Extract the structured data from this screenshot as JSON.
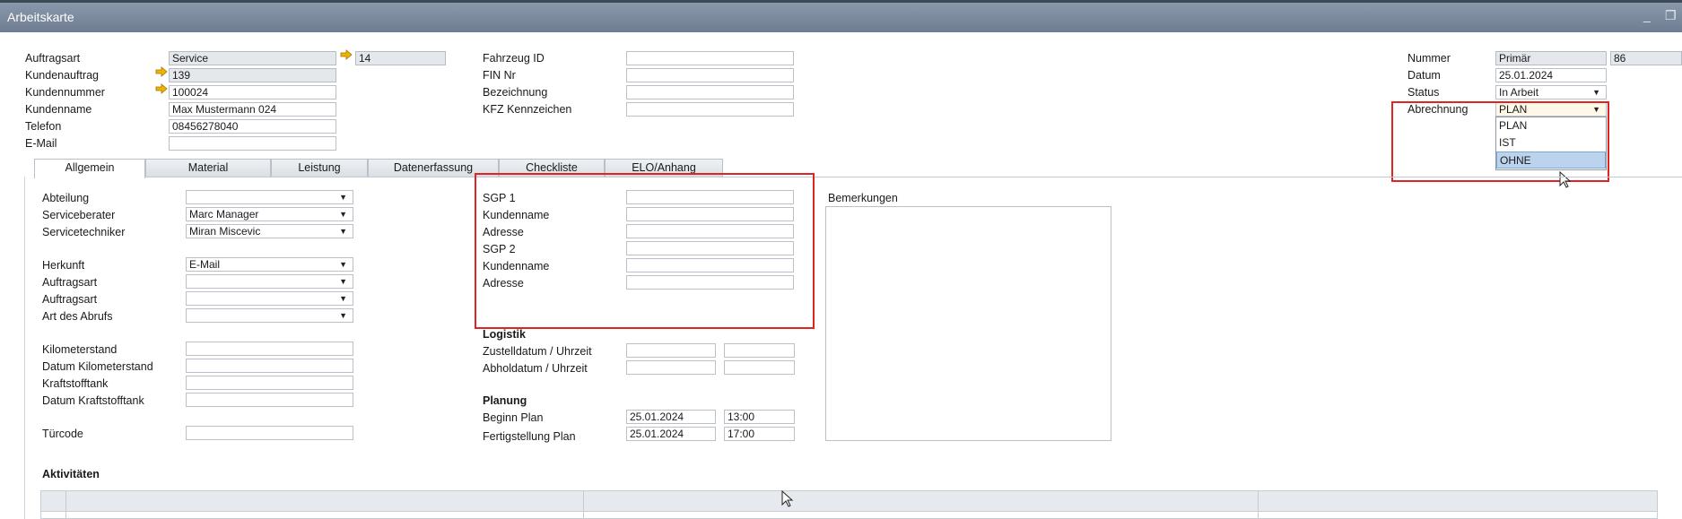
{
  "window": {
    "title": "Arbeitskarte",
    "minimize_label": "_",
    "restore_label": "❐"
  },
  "header_left": {
    "auftragsart": {
      "label": "Auftragsart",
      "value": "Service",
      "extra": "14"
    },
    "kundenauftrag": {
      "label": "Kundenauftrag",
      "value": "139"
    },
    "kundennummer": {
      "label": "Kundennummer",
      "value": "100024"
    },
    "kundenname": {
      "label": "Kundenname",
      "value": "Max Mustermann 024"
    },
    "telefon": {
      "label": "Telefon",
      "value": "08456278040"
    },
    "email": {
      "label": "E-Mail",
      "value": ""
    }
  },
  "header_mid": {
    "fahrzeug_id": {
      "label": "Fahrzeug ID",
      "value": ""
    },
    "fin_nr": {
      "label": "FIN Nr",
      "value": ""
    },
    "bezeichnung": {
      "label": "Bezeichnung",
      "value": ""
    },
    "kfz": {
      "label": "KFZ Kennzeichen",
      "value": ""
    }
  },
  "header_right": {
    "nummer": {
      "label": "Nummer",
      "series": "Primär",
      "value": "86"
    },
    "datum": {
      "label": "Datum",
      "value": "25.01.2024"
    },
    "status": {
      "label": "Status",
      "value": "In Arbeit"
    },
    "abrechnung": {
      "label": "Abrechnung",
      "value": "PLAN",
      "options": [
        "PLAN",
        "IST",
        "OHNE"
      ],
      "highlighted": "OHNE"
    }
  },
  "tabs": [
    "Allgemein",
    "Material",
    "Leistung",
    "Datenerfassung",
    "Checkliste",
    "ELO/Anhang"
  ],
  "allgemein": {
    "abteilung": {
      "label": "Abteilung",
      "value": ""
    },
    "serviceberater": {
      "label": "Serviceberater",
      "value": "Marc Manager"
    },
    "servicetechniker": {
      "label": "Servicetechniker",
      "value": "Miran Miscevic"
    },
    "herkunft": {
      "label": "Herkunft",
      "value": "E-Mail"
    },
    "auftragsart1": {
      "label": "Auftragsart",
      "value": ""
    },
    "auftragsart2": {
      "label": "Auftragsart",
      "value": ""
    },
    "art_abruf": {
      "label": "Art des Abrufs",
      "value": ""
    },
    "km": {
      "label": "Kilometerstand",
      "value": ""
    },
    "datum_km": {
      "label": "Datum Kilometerstand",
      "value": ""
    },
    "tank": {
      "label": "Kraftstofftank",
      "value": ""
    },
    "datum_tank": {
      "label": "Datum Kraftstofftank",
      "value": ""
    },
    "tuercode": {
      "label": "Türcode",
      "value": ""
    }
  },
  "sgp": {
    "sgp1": {
      "label": "SGP 1",
      "value": ""
    },
    "kundenname1": {
      "label": "Kundenname",
      "value": ""
    },
    "adresse1": {
      "label": "Adresse",
      "value": ""
    },
    "sgp2": {
      "label": "SGP 2",
      "value": ""
    },
    "kundenname2": {
      "label": "Kundenname",
      "value": ""
    },
    "adresse2": {
      "label": "Adresse",
      "value": ""
    }
  },
  "logistik": {
    "heading": "Logistik",
    "zustell": {
      "label": "Zustelldatum / Uhrzeit",
      "date": "",
      "time": ""
    },
    "abhol": {
      "label": "Abholdatum / Uhrzeit",
      "date": "",
      "time": ""
    }
  },
  "planung": {
    "heading": "Planung",
    "beginn": {
      "label": "Beginn Plan",
      "date": "25.01.2024",
      "time": "13:00"
    },
    "fertig": {
      "label": "Fertigstellung Plan",
      "date": "25.01.2024",
      "time": "17:00"
    }
  },
  "bemerkungen": {
    "label": "Bemerkungen",
    "value": ""
  },
  "aktivitaeten": {
    "heading": "Aktivitäten"
  },
  "colors": {
    "highlight_box": "#e02424",
    "arrow": "#f0b400",
    "selected_option": "#bcd3ee"
  }
}
